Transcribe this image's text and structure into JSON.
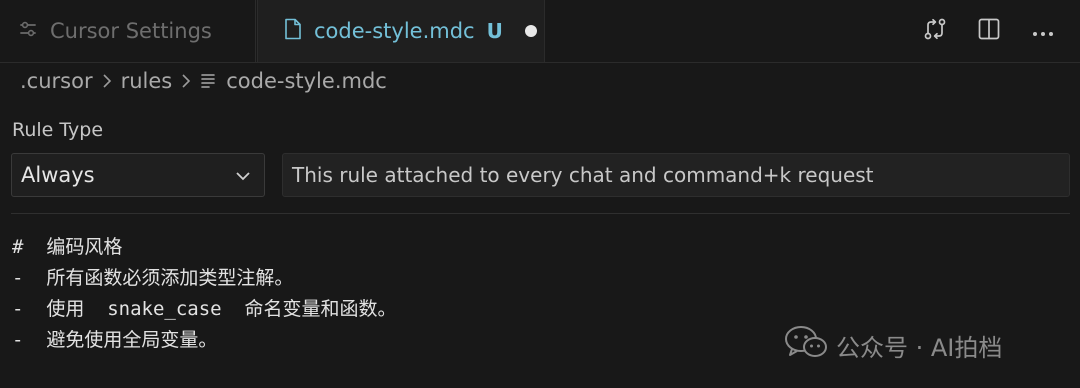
{
  "tabs": [
    {
      "label": "Cursor Settings",
      "active": false,
      "icon": "settings-sliders-icon"
    },
    {
      "label": "code-style.mdc",
      "active": true,
      "icon": "file-icon",
      "status": "U",
      "dirty": true
    }
  ],
  "tab_actions": [
    {
      "icon": "compare-changes-icon"
    },
    {
      "icon": "split-editor-icon"
    },
    {
      "icon": "more-actions-icon"
    }
  ],
  "breadcrumb": {
    "items": [
      ".cursor",
      "rules"
    ],
    "file": "code-style.mdc"
  },
  "rule": {
    "type_label": "Rule Type",
    "type_value": "Always",
    "description": "This rule attached to every chat and command+k request"
  },
  "editor": {
    "lines": [
      "#  编码风格",
      "-  所有函数必须添加类型注解。",
      "-  使用  snake_case  命名变量和函数。",
      "-  避免使用全局变量。"
    ]
  },
  "watermark": {
    "text": "公众号 · AI拍档"
  },
  "colors": {
    "background": "#181818",
    "active_tab_text": "#73c0d8",
    "inactive_tab_text": "#6e6e6e"
  }
}
